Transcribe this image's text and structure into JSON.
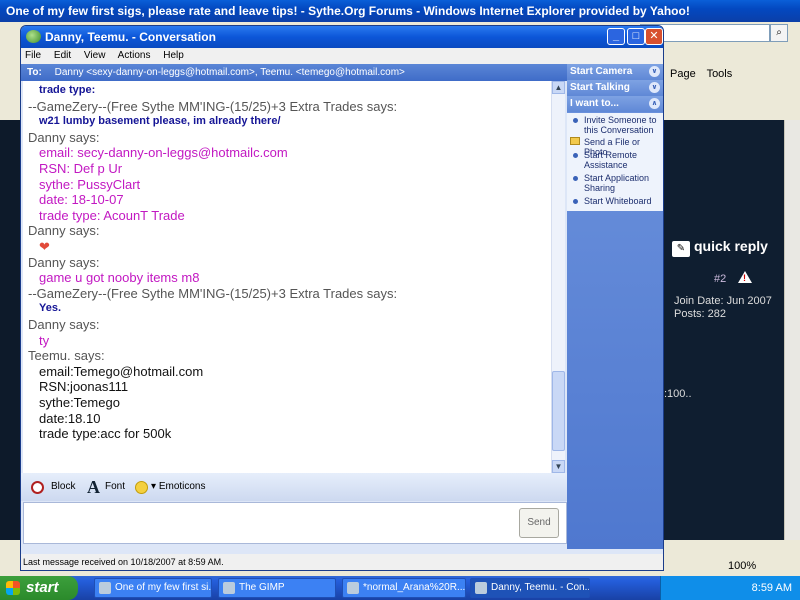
{
  "ie": {
    "title": "One of my few first sigs, please rate and leave tips! - Sythe.Org Forums - Windows Internet Explorer provided by Yahoo!",
    "toolbar": [
      "Page",
      "Tools"
    ],
    "quick_reply": "quick reply",
    "post_number": "#2",
    "join_date": "Join Date: Jun 2007",
    "posts": "Posts: 282",
    "gain": ":100..",
    "zoom": "100%"
  },
  "window": {
    "title": "Danny, Teemu. - Conversation",
    "menu": [
      "File",
      "Edit",
      "View",
      "Actions",
      "Help"
    ],
    "to_label": "To:",
    "to_value": "Danny <sexy-danny-on-leggs@hotmail.com>, Teemu. <temego@hotmail.com>"
  },
  "conversation": [
    {
      "text": "trade type:",
      "style": "b",
      "pad": true
    },
    {
      "text": "--GameZery--(Free Sythe MM'ING-(15/25)+3 Extra Trades says:",
      "style": "says",
      "pad": false
    },
    {
      "text": "w21 lumby basement please, im already there/",
      "style": "b",
      "pad": true
    },
    {
      "text": "Danny says:",
      "style": "says",
      "pad": false
    },
    {
      "text": "email:  secy-danny-on-leggs@hotmailc.com",
      "style": "p",
      "pad": true
    },
    {
      "text": "RSN:  Def p Ur",
      "style": "p",
      "pad": true
    },
    {
      "text": "sythe: PussyClart",
      "style": "p",
      "pad": true
    },
    {
      "text": "date:  18-10-07",
      "style": "p",
      "pad": true
    },
    {
      "text": "trade type: AcounT  Trade",
      "style": "p",
      "pad": true
    },
    {
      "text": "Danny says:",
      "style": "says",
      "pad": false
    },
    {
      "text": "",
      "style": "heart",
      "pad": true
    },
    {
      "text": "Danny says:",
      "style": "says",
      "pad": false
    },
    {
      "text": "game u got nooby items m8",
      "style": "p",
      "pad": true
    },
    {
      "text": "--GameZery--(Free Sythe MM'ING-(15/25)+3 Extra Trades says:",
      "style": "says",
      "pad": false
    },
    {
      "text": "Yes.",
      "style": "b",
      "pad": true
    },
    {
      "text": "Danny says:",
      "style": "says",
      "pad": false
    },
    {
      "text": "ty",
      "style": "p",
      "pad": true
    },
    {
      "text": "Teemu. says:",
      "style": "says",
      "pad": false
    },
    {
      "text": "email:Temego@hotmail.com",
      "style": "k",
      "pad": true
    },
    {
      "text": "RSN:joonas111",
      "style": "k",
      "pad": true
    },
    {
      "text": "sythe:Temego",
      "style": "k",
      "pad": true
    },
    {
      "text": "date:18.10",
      "style": "k",
      "pad": true
    },
    {
      "text": "trade type:acc for 500k",
      "style": "k",
      "pad": true
    }
  ],
  "format_bar": {
    "block": "Block",
    "font": "Font",
    "emoticons": "Emoticons"
  },
  "send_label": "Send",
  "last_message": "Last message received on 10/18/2007 at 8:59 AM.",
  "sidebar": {
    "headers": [
      "Start Camera",
      "Start Talking",
      "I want to..."
    ],
    "tasks": [
      "Invite Someone to this Conversation",
      "Send a File or Photo",
      "Start Remote Assistance",
      "Start Application Sharing",
      "Start Whiteboard"
    ]
  },
  "taskbar": {
    "start": "start",
    "items": [
      "One of my few first si...",
      "The GIMP",
      "*normal_Arana%20R...",
      "Danny, Teemu. - Con..."
    ],
    "clock": "8:59 AM"
  }
}
